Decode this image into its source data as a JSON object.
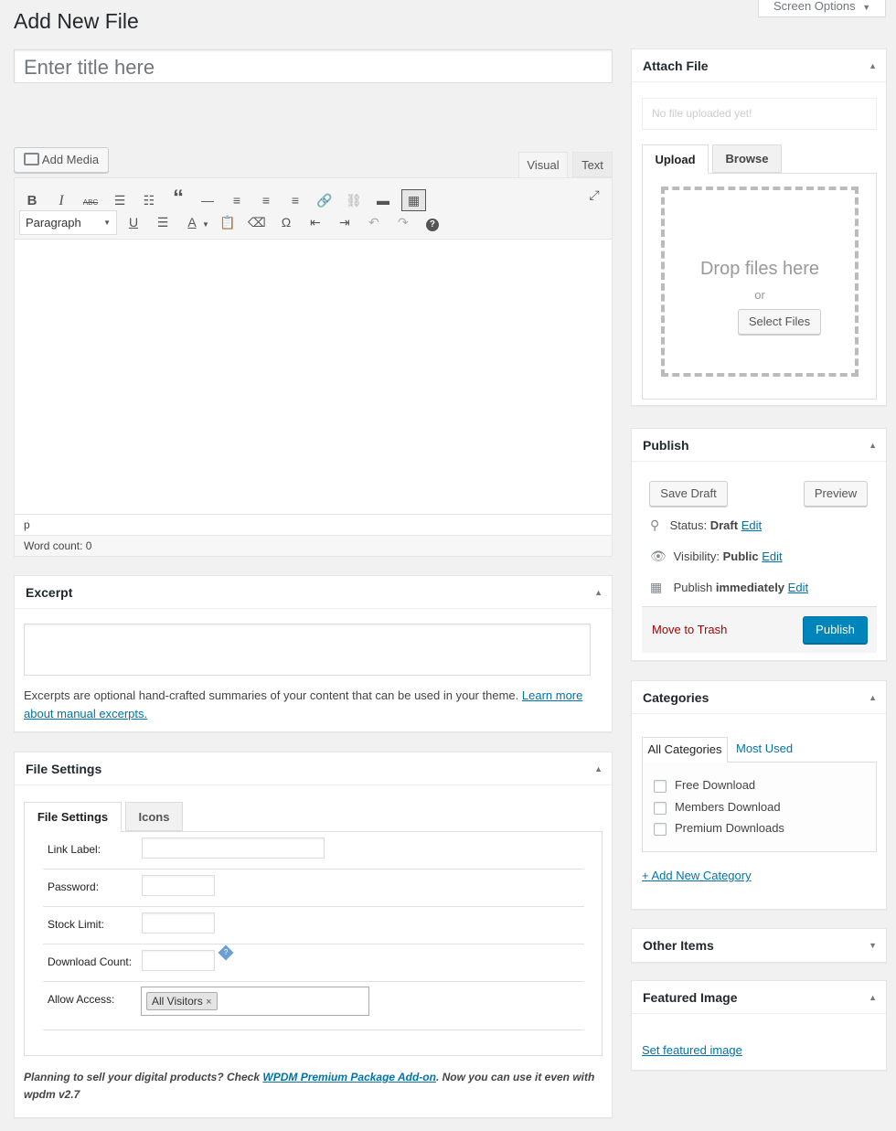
{
  "page": {
    "title": "Add New File",
    "screen_options": "Screen Options",
    "title_placeholder": "Enter title here"
  },
  "editor": {
    "add_media": "Add Media",
    "tab_visual": "Visual",
    "tab_text": "Text",
    "format_select": "Paragraph",
    "path": "p",
    "word_count": "Word count: 0"
  },
  "excerpt": {
    "title": "Excerpt",
    "help_text": "Excerpts are optional hand-crafted summaries of your content that can be used in your theme.",
    "help_link": "Learn more about manual excerpts."
  },
  "file_settings": {
    "title": "File Settings",
    "tabs": [
      "File Settings",
      "Icons"
    ],
    "fields": {
      "link_label": "Link Label:",
      "password": "Password:",
      "stock_limit": "Stock Limit:",
      "download_count": "Download Count:",
      "allow_access": "Allow Access:"
    },
    "access_tag": "All Visitors",
    "note_prefix": "Planning to sell your digital products? Check",
    "note_link": "WPDM Premium Package Add-on",
    "note_suffix": ". Now you can use it even with wpdm v2.7"
  },
  "attach_file": {
    "title": "Attach File",
    "placeholder": "No file uploaded yet!",
    "tabs": [
      "Upload",
      "Browse"
    ],
    "drop_text": "Drop files here",
    "or_text": "or",
    "select_files": "Select Files"
  },
  "publish": {
    "title": "Publish",
    "save_draft": "Save Draft",
    "preview": "Preview",
    "status_label": "Status:",
    "status_value": "Draft",
    "visibility_label": "Visibility:",
    "visibility_value": "Public",
    "publish_label": "Publish",
    "publish_value": "immediately",
    "edit": "Edit",
    "move_to_trash": "Move to Trash",
    "publish_button": "Publish"
  },
  "categories": {
    "title": "Categories",
    "tabs": [
      "All Categories",
      "Most Used"
    ],
    "items": [
      "Free Download",
      "Members Download",
      "Premium Downloads"
    ],
    "add_new": "+ Add New Category"
  },
  "other_items": {
    "title": "Other Items"
  },
  "featured_image": {
    "title": "Featured Image",
    "link": "Set featured image"
  },
  "colors": {
    "primary": "#0085ba",
    "link": "#0073aa",
    "trash": "#a00"
  }
}
